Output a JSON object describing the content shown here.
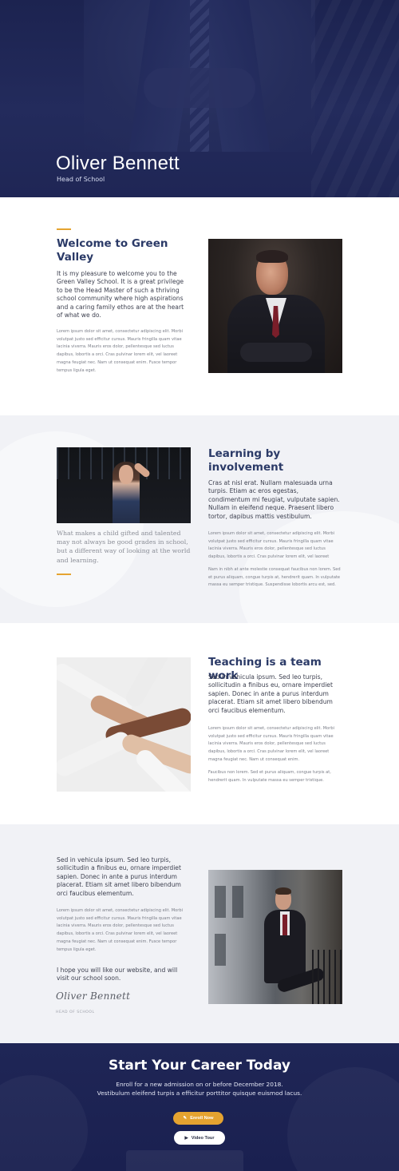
{
  "hero": {
    "title": "Oliver Bennett",
    "subtitle": "Head of School"
  },
  "welcome": {
    "heading": "Welcome to Green Valley",
    "lead": "It is my pleasure to welcome you to the Green Valley School. It is a great privilege to be the Head Master of such a thriving school community where high aspirations and a caring family ethos are at the heart of what we do.",
    "body": "Lorem ipsum dolor sit amet, consectetur adipiscing elit. Morbi volutpat justo sed efficitur cursus. Mauris fringilla quam vitae lacinia viverra. Mauris eros dolor, pellentesque sed luctus dapibus, lobortis a orci. Cras pulvinar lorem elit, vel laoreet magna feugiat nec. Nam ut consequat enim. Fusce tempor tempus ligula eget."
  },
  "learning": {
    "heading": "Learning by involvement",
    "lead": "Cras at nisl erat. Nullam malesuada urna turpis. Etiam ac eros egestas, condimentum mi feugiat, vulputate sapien. Nullam in eleifend neque. Praesent libero tortor, dapibus mattis vestibulum.",
    "body1": "Lorem ipsum dolor sit amet, consectetur adipiscing elit. Morbi volutpat justo sed efficitur cursus. Mauris fringilla quam vitae lacinia viverra. Mauris eros dolor, pellentesque sed luctus dapibus, lobortis a orci. Cras pulvinar lorem elit, vel laoreet",
    "body2": "Nam in nibh at ante molestie consequat faucibus non lorem. Sed et purus aliquam, congue turpis at, hendrerit quam. In vulputate massa eu semper tristique. Suspendisse lobortis arcu est, sed.",
    "quote": "What makes a child gifted and talented may not always be good grades in school, but a different way of looking at the world and learning."
  },
  "teaching": {
    "heading": "Teaching is a team work",
    "lead": "Sed in vehicula ipsum. Sed leo turpis, sollicitudin a finibus eu, ornare imperdiet sapien. Donec in ante a purus interdum placerat. Etiam sit amet libero bibendum orci faucibus elementum.",
    "body1": "Lorem ipsum dolor sit amet, consectetur adipiscing elit. Morbi volutpat justo sed efficitur cursus. Mauris fringilla quam vitae lacinia viverra. Mauris eros dolor, pellentesque sed luctus dapibus, lobortis a orci. Cras pulvinar lorem elit, vel laoreet magna feugiat nec. Nam ut consequat enim.",
    "body2": "Faucibus non lorem. Sed et purus aliquam, congue turpis at, hendrerit quam. In vulputate massa eu semper tristique."
  },
  "closing": {
    "lead": "Sed in vehicula ipsum. Sed leo turpis, sollicitudin a finibus eu, ornare imperdiet sapien. Donec in ante a purus interdum placerat. Etiam sit amet libero bibendum orci faucibus elementum.",
    "body": "Lorem ipsum dolor sit amet, consectetur adipiscing elit. Morbi volutpat justo sed efficitur cursus. Mauris fringilla quam vitae lacinia viverra. Mauris eros dolor, pellentesque sed luctus dapibus, lobortis a orci. Cras pulvinar lorem elit, vel laoreet magna feugiat nec. Nam ut consequat enim. Fusce tempor tempus ligula eget.",
    "hope": "I hope you will like our website, and will visit our school soon.",
    "signature": "Oliver Bennett",
    "signature_role": "HEAD OF SCHOOL"
  },
  "cta": {
    "title": "Start Your Career Today",
    "line1": "Enroll for a new admission on or before December 2018.",
    "line2": "Vestibulum eleifend turpis a efficitur porttitor quisque euismod lacus.",
    "enroll_label": "Enroll Now",
    "enroll_icon": "pencil-icon",
    "video_label": "Video Tour",
    "video_icon": "play-icon"
  },
  "colors": {
    "navy": "#1f2656",
    "heading": "#2b3a67",
    "accent": "#e5a330",
    "section_alt": "#f1f2f6"
  }
}
